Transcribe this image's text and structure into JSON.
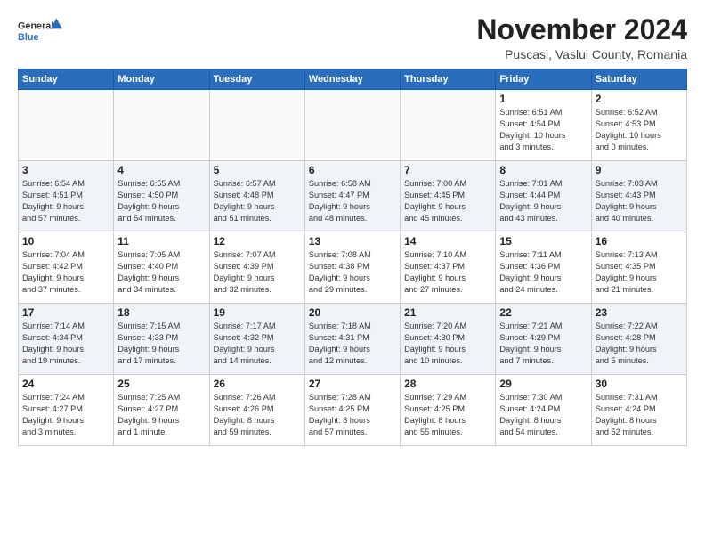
{
  "logo": {
    "general": "General",
    "blue": "Blue"
  },
  "header": {
    "month": "November 2024",
    "location": "Puscasi, Vaslui County, Romania"
  },
  "weekdays": [
    "Sunday",
    "Monday",
    "Tuesday",
    "Wednesday",
    "Thursday",
    "Friday",
    "Saturday"
  ],
  "weeks": [
    [
      {
        "day": "",
        "info": ""
      },
      {
        "day": "",
        "info": ""
      },
      {
        "day": "",
        "info": ""
      },
      {
        "day": "",
        "info": ""
      },
      {
        "day": "",
        "info": ""
      },
      {
        "day": "1",
        "info": "Sunrise: 6:51 AM\nSunset: 4:54 PM\nDaylight: 10 hours\nand 3 minutes."
      },
      {
        "day": "2",
        "info": "Sunrise: 6:52 AM\nSunset: 4:53 PM\nDaylight: 10 hours\nand 0 minutes."
      }
    ],
    [
      {
        "day": "3",
        "info": "Sunrise: 6:54 AM\nSunset: 4:51 PM\nDaylight: 9 hours\nand 57 minutes."
      },
      {
        "day": "4",
        "info": "Sunrise: 6:55 AM\nSunset: 4:50 PM\nDaylight: 9 hours\nand 54 minutes."
      },
      {
        "day": "5",
        "info": "Sunrise: 6:57 AM\nSunset: 4:48 PM\nDaylight: 9 hours\nand 51 minutes."
      },
      {
        "day": "6",
        "info": "Sunrise: 6:58 AM\nSunset: 4:47 PM\nDaylight: 9 hours\nand 48 minutes."
      },
      {
        "day": "7",
        "info": "Sunrise: 7:00 AM\nSunset: 4:45 PM\nDaylight: 9 hours\nand 45 minutes."
      },
      {
        "day": "8",
        "info": "Sunrise: 7:01 AM\nSunset: 4:44 PM\nDaylight: 9 hours\nand 43 minutes."
      },
      {
        "day": "9",
        "info": "Sunrise: 7:03 AM\nSunset: 4:43 PM\nDaylight: 9 hours\nand 40 minutes."
      }
    ],
    [
      {
        "day": "10",
        "info": "Sunrise: 7:04 AM\nSunset: 4:42 PM\nDaylight: 9 hours\nand 37 minutes."
      },
      {
        "day": "11",
        "info": "Sunrise: 7:05 AM\nSunset: 4:40 PM\nDaylight: 9 hours\nand 34 minutes."
      },
      {
        "day": "12",
        "info": "Sunrise: 7:07 AM\nSunset: 4:39 PM\nDaylight: 9 hours\nand 32 minutes."
      },
      {
        "day": "13",
        "info": "Sunrise: 7:08 AM\nSunset: 4:38 PM\nDaylight: 9 hours\nand 29 minutes."
      },
      {
        "day": "14",
        "info": "Sunrise: 7:10 AM\nSunset: 4:37 PM\nDaylight: 9 hours\nand 27 minutes."
      },
      {
        "day": "15",
        "info": "Sunrise: 7:11 AM\nSunset: 4:36 PM\nDaylight: 9 hours\nand 24 minutes."
      },
      {
        "day": "16",
        "info": "Sunrise: 7:13 AM\nSunset: 4:35 PM\nDaylight: 9 hours\nand 21 minutes."
      }
    ],
    [
      {
        "day": "17",
        "info": "Sunrise: 7:14 AM\nSunset: 4:34 PM\nDaylight: 9 hours\nand 19 minutes."
      },
      {
        "day": "18",
        "info": "Sunrise: 7:15 AM\nSunset: 4:33 PM\nDaylight: 9 hours\nand 17 minutes."
      },
      {
        "day": "19",
        "info": "Sunrise: 7:17 AM\nSunset: 4:32 PM\nDaylight: 9 hours\nand 14 minutes."
      },
      {
        "day": "20",
        "info": "Sunrise: 7:18 AM\nSunset: 4:31 PM\nDaylight: 9 hours\nand 12 minutes."
      },
      {
        "day": "21",
        "info": "Sunrise: 7:20 AM\nSunset: 4:30 PM\nDaylight: 9 hours\nand 10 minutes."
      },
      {
        "day": "22",
        "info": "Sunrise: 7:21 AM\nSunset: 4:29 PM\nDaylight: 9 hours\nand 7 minutes."
      },
      {
        "day": "23",
        "info": "Sunrise: 7:22 AM\nSunset: 4:28 PM\nDaylight: 9 hours\nand 5 minutes."
      }
    ],
    [
      {
        "day": "24",
        "info": "Sunrise: 7:24 AM\nSunset: 4:27 PM\nDaylight: 9 hours\nand 3 minutes."
      },
      {
        "day": "25",
        "info": "Sunrise: 7:25 AM\nSunset: 4:27 PM\nDaylight: 9 hours\nand 1 minute."
      },
      {
        "day": "26",
        "info": "Sunrise: 7:26 AM\nSunset: 4:26 PM\nDaylight: 8 hours\nand 59 minutes."
      },
      {
        "day": "27",
        "info": "Sunrise: 7:28 AM\nSunset: 4:25 PM\nDaylight: 8 hours\nand 57 minutes."
      },
      {
        "day": "28",
        "info": "Sunrise: 7:29 AM\nSunset: 4:25 PM\nDaylight: 8 hours\nand 55 minutes."
      },
      {
        "day": "29",
        "info": "Sunrise: 7:30 AM\nSunset: 4:24 PM\nDaylight: 8 hours\nand 54 minutes."
      },
      {
        "day": "30",
        "info": "Sunrise: 7:31 AM\nSunset: 4:24 PM\nDaylight: 8 hours\nand 52 minutes."
      }
    ]
  ]
}
